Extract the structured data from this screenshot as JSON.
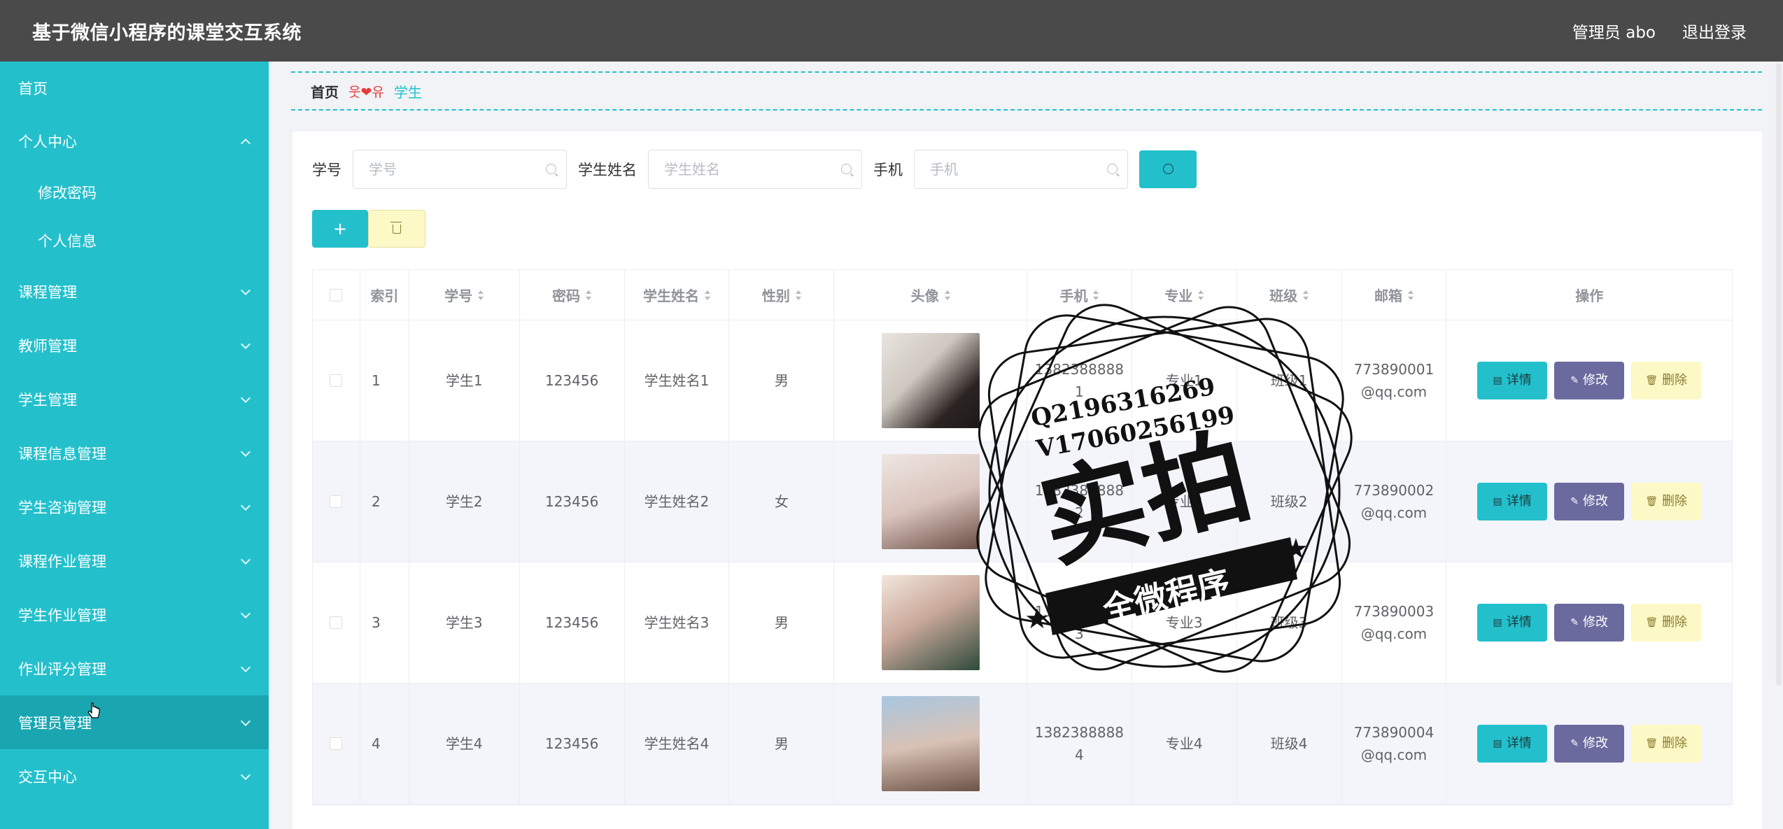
{
  "header": {
    "title": "基于微信小程序的课堂交互系统",
    "user": "管理员 abo",
    "logout": "退出登录"
  },
  "sidebar": {
    "items": [
      {
        "label": "首页"
      },
      {
        "label": "个人中心"
      },
      {
        "label": "修改密码"
      },
      {
        "label": "个人信息"
      },
      {
        "label": "课程管理"
      },
      {
        "label": "教师管理"
      },
      {
        "label": "学生管理"
      },
      {
        "label": "课程信息管理"
      },
      {
        "label": "学生咨询管理"
      },
      {
        "label": "课程作业管理"
      },
      {
        "label": "学生作业管理"
      },
      {
        "label": "作业评分管理"
      },
      {
        "label": "管理员管理"
      },
      {
        "label": "交互中心"
      }
    ]
  },
  "breadcrumb": {
    "home": "首页",
    "separator": "웃❤유",
    "current": "学生"
  },
  "search": {
    "student_no_label": "学号",
    "student_no_placeholder": "学号",
    "name_label": "学生姓名",
    "name_placeholder": "学生姓名",
    "phone_label": "手机",
    "phone_placeholder": "手机"
  },
  "toolbar": {
    "add_label": "+"
  },
  "table": {
    "headers": [
      "索引",
      "学号",
      "密码",
      "学生姓名",
      "性别",
      "头像",
      "手机",
      "专业",
      "班级",
      "邮箱",
      "操作"
    ],
    "rows": [
      {
        "idx": "1",
        "no": "学生1",
        "pwd": "123456",
        "name": "学生姓名1",
        "gender": "男",
        "phone": "1382388888\n1",
        "major": "专业1",
        "cls": "班级1",
        "email": "773890001\n@qq.com"
      },
      {
        "idx": "2",
        "no": "学生2",
        "pwd": "123456",
        "name": "学生姓名2",
        "gender": "女",
        "phone": "1382388888\n2",
        "major": "专业2",
        "cls": "班级2",
        "email": "773890002\n@qq.com"
      },
      {
        "idx": "3",
        "no": "学生3",
        "pwd": "123456",
        "name": "学生姓名3",
        "gender": "男",
        "phone": "1382388888\n3",
        "major": "专业3",
        "cls": "班级3",
        "email": "773890003\n@qq.com"
      },
      {
        "idx": "4",
        "no": "学生4",
        "pwd": "123456",
        "name": "学生姓名4",
        "gender": "男",
        "phone": "1382388888\n4",
        "major": "专业4",
        "cls": "班级4",
        "email": "773890004\n@qq.com"
      }
    ],
    "actions": {
      "detail": "详情",
      "edit": "修改",
      "delete": "删除"
    }
  },
  "watermark": {
    "line1": "Q2196316269",
    "line2": "V17060256199",
    "big": "实拍",
    "band": "全微程序"
  },
  "colors": {
    "accent": "#23c0cc",
    "header_bg": "#4a4a4a",
    "edit": "#6b6a9e",
    "delete": "#fdf9c6"
  }
}
